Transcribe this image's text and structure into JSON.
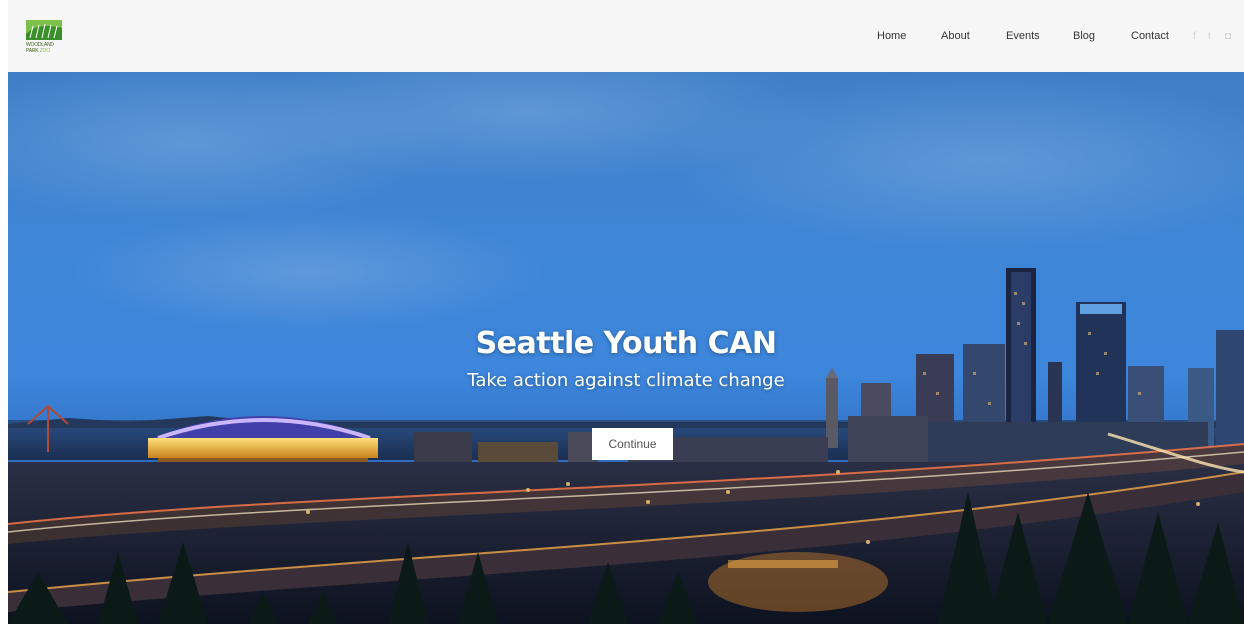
{
  "brand": {
    "logo_line1": "WOODLAND",
    "logo_line2": "PARK",
    "logo_line3": "ZOO",
    "colors": {
      "dark_green": "#3a5f1a",
      "light_green": "#7cc24a"
    }
  },
  "nav": {
    "items": [
      {
        "label": "Home"
      },
      {
        "label": "About"
      },
      {
        "label": "Events"
      },
      {
        "label": "Blog"
      },
      {
        "label": "Contact"
      }
    ],
    "social": [
      {
        "icon": "facebook-icon",
        "glyph": "f"
      },
      {
        "icon": "twitter-icon",
        "glyph": "t"
      },
      {
        "icon": "instagram-icon",
        "glyph": "◘"
      }
    ]
  },
  "hero": {
    "title": "Seattle Youth CAN",
    "subtitle": "Take action against climate change",
    "button_label": "Continue"
  }
}
